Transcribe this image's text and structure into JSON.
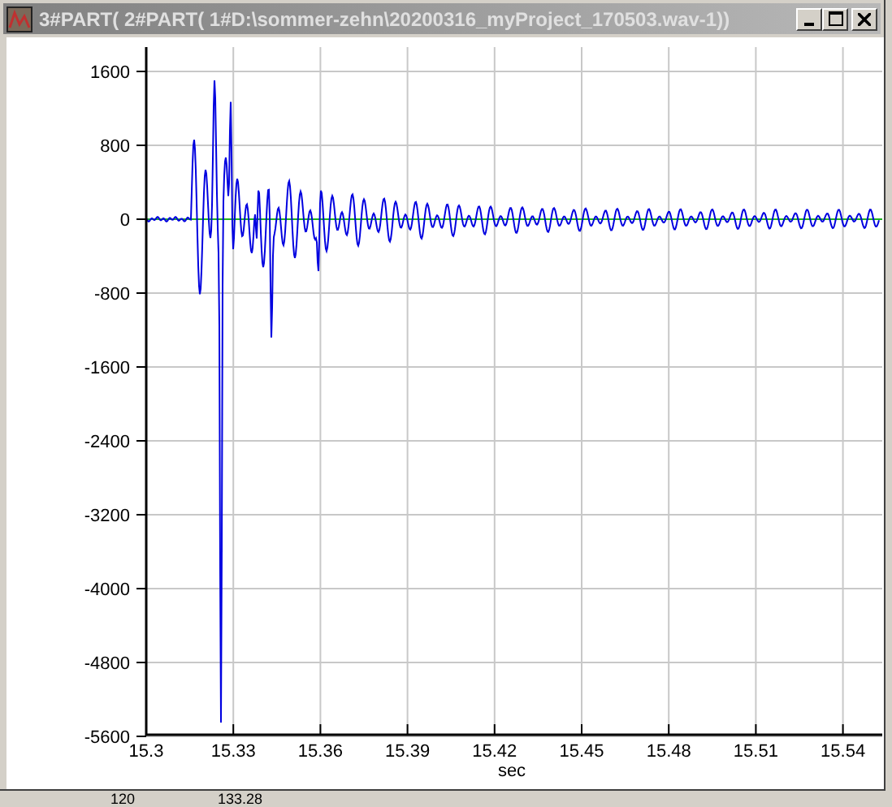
{
  "window": {
    "title": "3#PART( 2#PART( 1#D:\\sommer-zehn\\20200316_myProject_170503.wav-1))"
  },
  "plot": {
    "y_ticks": [
      "1600",
      "800",
      "0",
      "-800",
      "-1600",
      "-2400",
      "-3200",
      "-4000",
      "-4800",
      "-5600"
    ],
    "x_ticks": [
      "15.3",
      "15.33",
      "15.36",
      "15.39",
      "15.42",
      "15.45",
      "15.48",
      "15.51",
      "15.54"
    ],
    "xlabel": "sec"
  },
  "background_window": {
    "texts": [
      "120",
      "133.28"
    ]
  }
}
